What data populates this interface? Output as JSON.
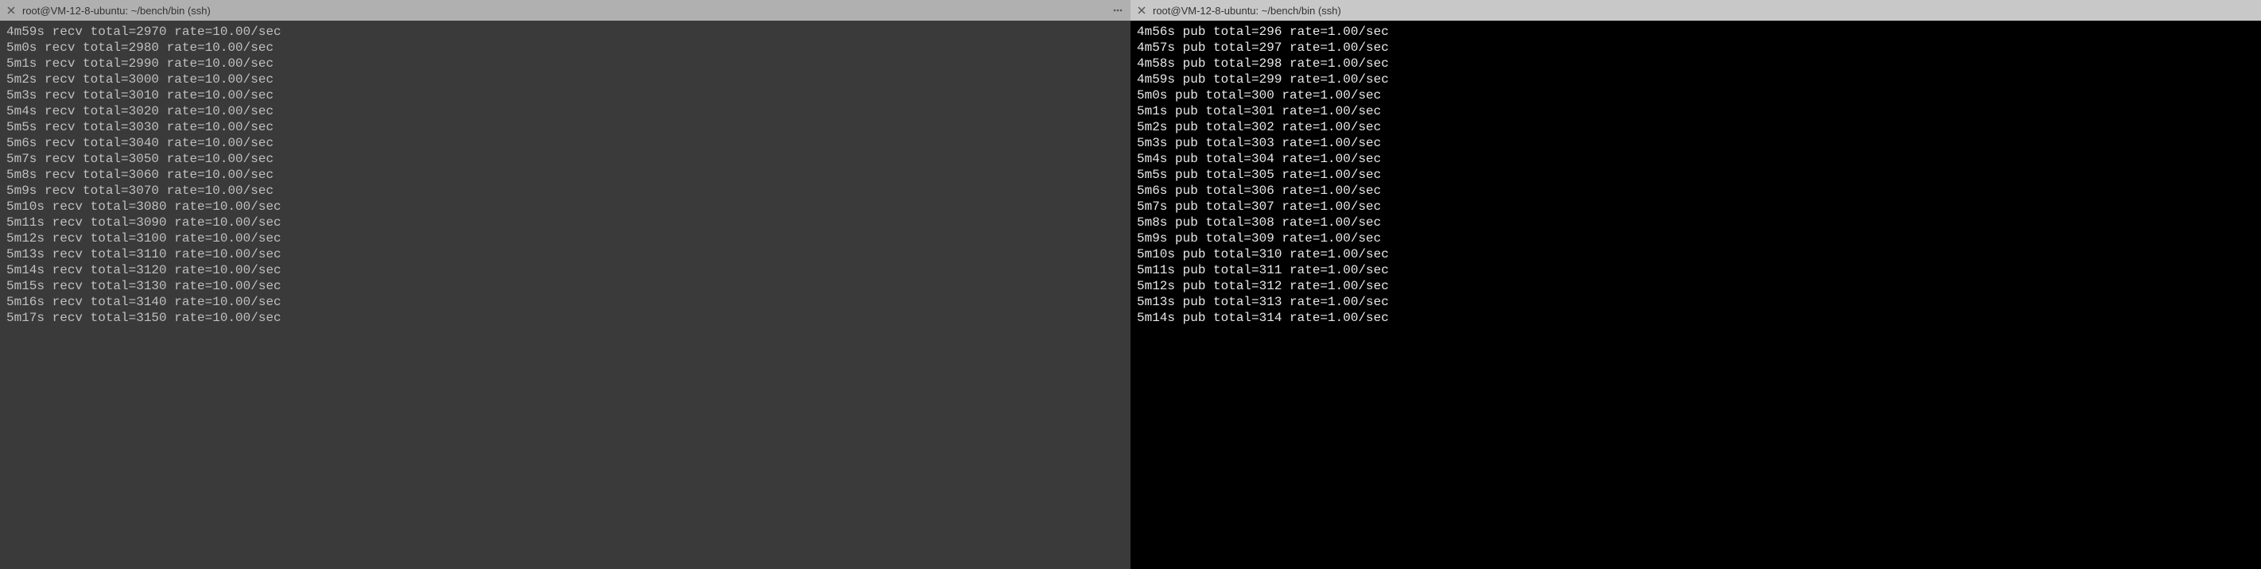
{
  "left_pane": {
    "tab_title": "root@VM-12-8-ubuntu: ~/bench/bin (ssh)",
    "lines": [
      {
        "time": "4m59s",
        "op": "recv",
        "total": "2970",
        "rate": "10.00/sec"
      },
      {
        "time": "5m0s",
        "op": "recv",
        "total": "2980",
        "rate": "10.00/sec"
      },
      {
        "time": "5m1s",
        "op": "recv",
        "total": "2990",
        "rate": "10.00/sec"
      },
      {
        "time": "5m2s",
        "op": "recv",
        "total": "3000",
        "rate": "10.00/sec"
      },
      {
        "time": "5m3s",
        "op": "recv",
        "total": "3010",
        "rate": "10.00/sec"
      },
      {
        "time": "5m4s",
        "op": "recv",
        "total": "3020",
        "rate": "10.00/sec"
      },
      {
        "time": "5m5s",
        "op": "recv",
        "total": "3030",
        "rate": "10.00/sec"
      },
      {
        "time": "5m6s",
        "op": "recv",
        "total": "3040",
        "rate": "10.00/sec"
      },
      {
        "time": "5m7s",
        "op": "recv",
        "total": "3050",
        "rate": "10.00/sec"
      },
      {
        "time": "5m8s",
        "op": "recv",
        "total": "3060",
        "rate": "10.00/sec"
      },
      {
        "time": "5m9s",
        "op": "recv",
        "total": "3070",
        "rate": "10.00/sec"
      },
      {
        "time": "5m10s",
        "op": "recv",
        "total": "3080",
        "rate": "10.00/sec"
      },
      {
        "time": "5m11s",
        "op": "recv",
        "total": "3090",
        "rate": "10.00/sec"
      },
      {
        "time": "5m12s",
        "op": "recv",
        "total": "3100",
        "rate": "10.00/sec"
      },
      {
        "time": "5m13s",
        "op": "recv",
        "total": "3110",
        "rate": "10.00/sec"
      },
      {
        "time": "5m14s",
        "op": "recv",
        "total": "3120",
        "rate": "10.00/sec"
      },
      {
        "time": "5m15s",
        "op": "recv",
        "total": "3130",
        "rate": "10.00/sec"
      },
      {
        "time": "5m16s",
        "op": "recv",
        "total": "3140",
        "rate": "10.00/sec"
      },
      {
        "time": "5m17s",
        "op": "recv",
        "total": "3150",
        "rate": "10.00/sec"
      }
    ]
  },
  "right_pane": {
    "tab_title": "root@VM-12-8-ubuntu: ~/bench/bin (ssh)",
    "lines": [
      {
        "time": "4m56s",
        "op": "pub",
        "total": "296",
        "rate": "1.00/sec"
      },
      {
        "time": "4m57s",
        "op": "pub",
        "total": "297",
        "rate": "1.00/sec"
      },
      {
        "time": "4m58s",
        "op": "pub",
        "total": "298",
        "rate": "1.00/sec"
      },
      {
        "time": "4m59s",
        "op": "pub",
        "total": "299",
        "rate": "1.00/sec"
      },
      {
        "time": "5m0s",
        "op": "pub",
        "total": "300",
        "rate": "1.00/sec"
      },
      {
        "time": "5m1s",
        "op": "pub",
        "total": "301",
        "rate": "1.00/sec"
      },
      {
        "time": "5m2s",
        "op": "pub",
        "total": "302",
        "rate": "1.00/sec"
      },
      {
        "time": "5m3s",
        "op": "pub",
        "total": "303",
        "rate": "1.00/sec"
      },
      {
        "time": "5m4s",
        "op": "pub",
        "total": "304",
        "rate": "1.00/sec"
      },
      {
        "time": "5m5s",
        "op": "pub",
        "total": "305",
        "rate": "1.00/sec"
      },
      {
        "time": "5m6s",
        "op": "pub",
        "total": "306",
        "rate": "1.00/sec"
      },
      {
        "time": "5m7s",
        "op": "pub",
        "total": "307",
        "rate": "1.00/sec"
      },
      {
        "time": "5m8s",
        "op": "pub",
        "total": "308",
        "rate": "1.00/sec"
      },
      {
        "time": "5m9s",
        "op": "pub",
        "total": "309",
        "rate": "1.00/sec"
      },
      {
        "time": "5m10s",
        "op": "pub",
        "total": "310",
        "rate": "1.00/sec"
      },
      {
        "time": "5m11s",
        "op": "pub",
        "total": "311",
        "rate": "1.00/sec"
      },
      {
        "time": "5m12s",
        "op": "pub",
        "total": "312",
        "rate": "1.00/sec"
      },
      {
        "time": "5m13s",
        "op": "pub",
        "total": "313",
        "rate": "1.00/sec"
      },
      {
        "time": "5m14s",
        "op": "pub",
        "total": "314",
        "rate": "1.00/sec"
      }
    ]
  }
}
